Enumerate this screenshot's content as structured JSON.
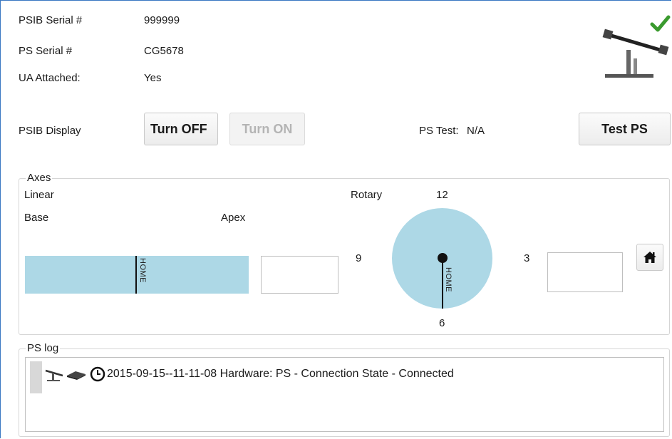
{
  "info": {
    "psib_serial_label": "PSIB Serial #",
    "psib_serial_value": "999999",
    "ps_serial_label": "PS Serial #",
    "ps_serial_value": "CG5678",
    "ua_attached_label": "UA Attached:",
    "ua_attached_value": "Yes"
  },
  "status_icon": "positioner-check-icon",
  "display": {
    "label": "PSIB Display",
    "turn_off_label": "Turn OFF",
    "turn_on_label": "Turn ON",
    "ps_test_label": "PS Test:",
    "ps_test_value": "N/A",
    "test_ps_label": "Test PS"
  },
  "axes": {
    "legend": "Axes",
    "linear_label": "Linear",
    "base_label": "Base",
    "apex_label": "Apex",
    "linear_home_label": "HOME",
    "linear_value": "",
    "rotary_label": "Rotary",
    "dial_12": "12",
    "dial_9": "9",
    "dial_3": "3",
    "dial_6": "6",
    "rotary_home_label": "HOME",
    "rotary_value": "",
    "home_button_icon": "house-icon"
  },
  "log": {
    "legend": "PS log",
    "entries": [
      {
        "icons": [
          "positioner-icon",
          "chip-icon",
          "clock-icon"
        ],
        "text": "2015-09-15--11-11-08 Hardware: PS - Connection State - Connected"
      }
    ]
  },
  "colors": {
    "accent_fill": "#add8e6",
    "check_green": "#3a9a2e",
    "frame_blue": "#3a78c2"
  }
}
